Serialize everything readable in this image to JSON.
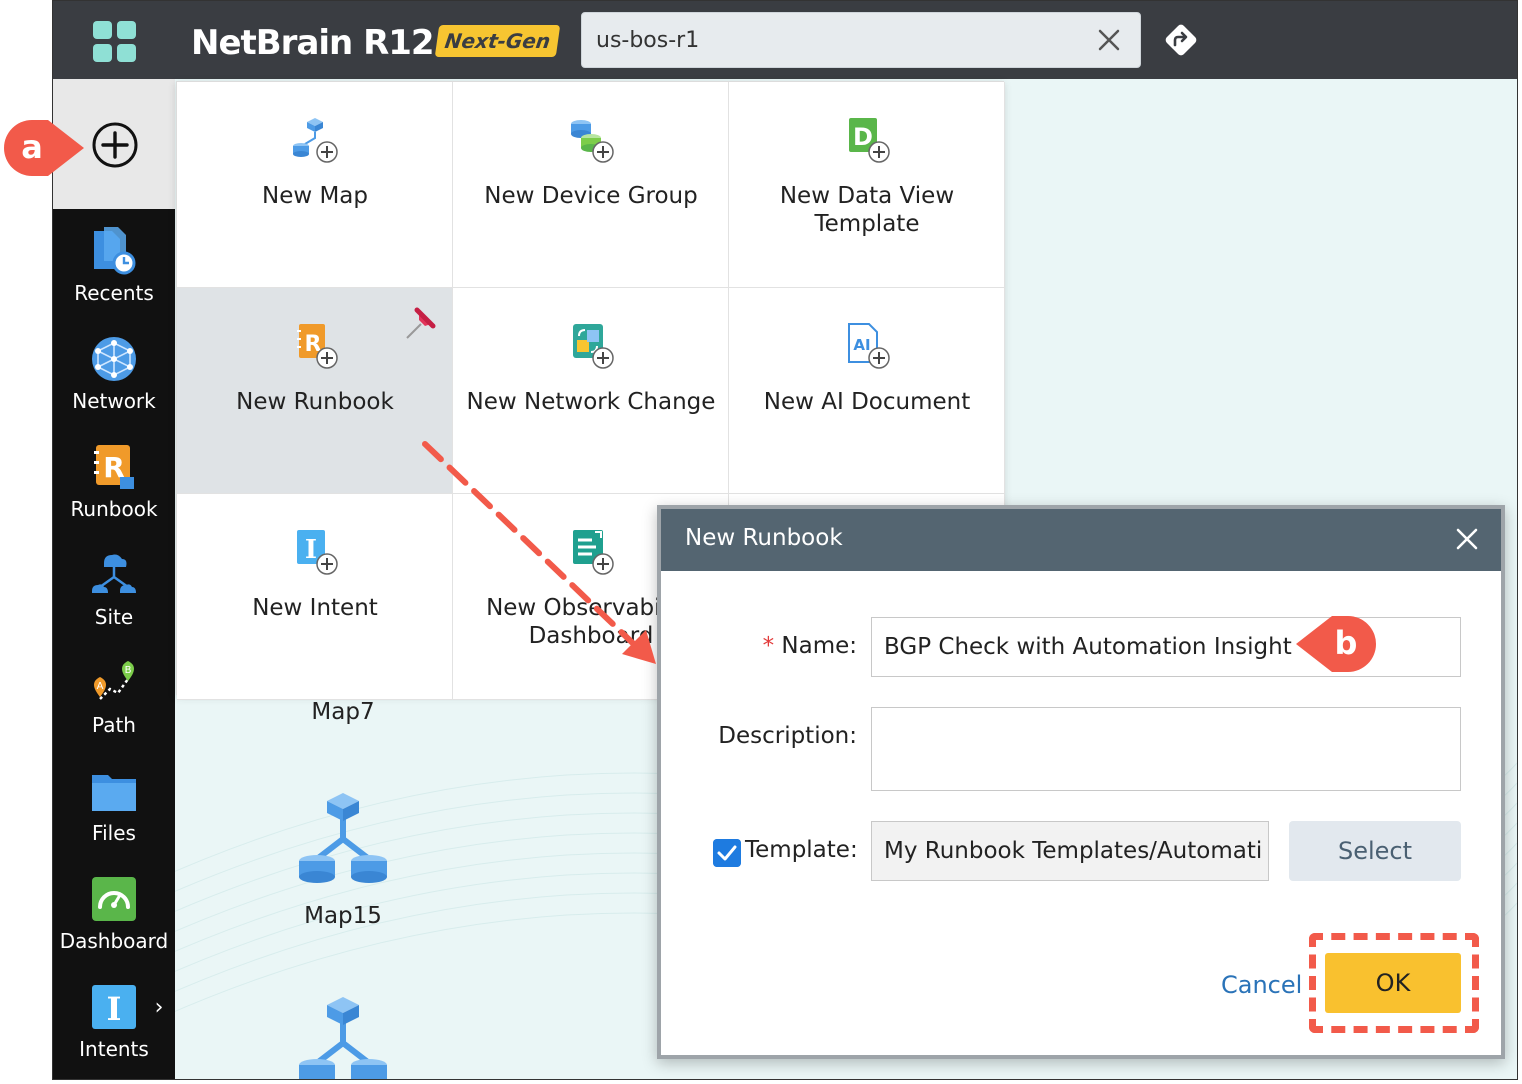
{
  "app": {
    "logo_text": "NetBrain R12",
    "logo_badge": "Next-Gen",
    "brand_accent": "#f7c531"
  },
  "search": {
    "value": "us-bos-r1"
  },
  "sidebar": {
    "items": [
      {
        "label": "Recents",
        "icon": "recents-icon"
      },
      {
        "label": "Network",
        "icon": "network-icon"
      },
      {
        "label": "Runbook",
        "icon": "runbook-icon"
      },
      {
        "label": "Site",
        "icon": "site-icon"
      },
      {
        "label": "Path",
        "icon": "path-icon"
      },
      {
        "label": "Files",
        "icon": "files-icon"
      },
      {
        "label": "Dashboard",
        "icon": "dashboard-icon"
      },
      {
        "label": "Intents",
        "icon": "intents-icon"
      }
    ]
  },
  "create_menu": {
    "tiles": [
      {
        "label": "New Map",
        "icon": "new-map-icon"
      },
      {
        "label": "New Device Group",
        "icon": "new-device-group-icon"
      },
      {
        "label": "New Data View Template",
        "icon": "new-data-view-template-icon"
      },
      {
        "label": "New Runbook",
        "icon": "new-runbook-icon",
        "highlighted": true
      },
      {
        "label": "New Network Change",
        "icon": "new-network-change-icon"
      },
      {
        "label": "New AI Document",
        "icon": "new-ai-document-icon"
      },
      {
        "label": "New Intent",
        "icon": "new-intent-icon"
      },
      {
        "label": "New Observability Dashboard",
        "icon": "new-observability-dashboard-icon"
      }
    ]
  },
  "background_maps": [
    {
      "label": "Map7"
    },
    {
      "label": "Map15"
    }
  ],
  "dialog": {
    "title": "New Runbook",
    "name_label": "Name:",
    "name_required_mark": "*",
    "name_value": "BGP Check with Automation Insight",
    "description_label": "Description:",
    "description_value": "",
    "template_label": "Template:",
    "template_checked": true,
    "template_value": "My Runbook Templates/Automati",
    "select_label": "Select",
    "cancel_label": "Cancel",
    "ok_label": "OK"
  },
  "callouts": {
    "a": "a",
    "b": "b",
    "color": "#f25a4a"
  }
}
